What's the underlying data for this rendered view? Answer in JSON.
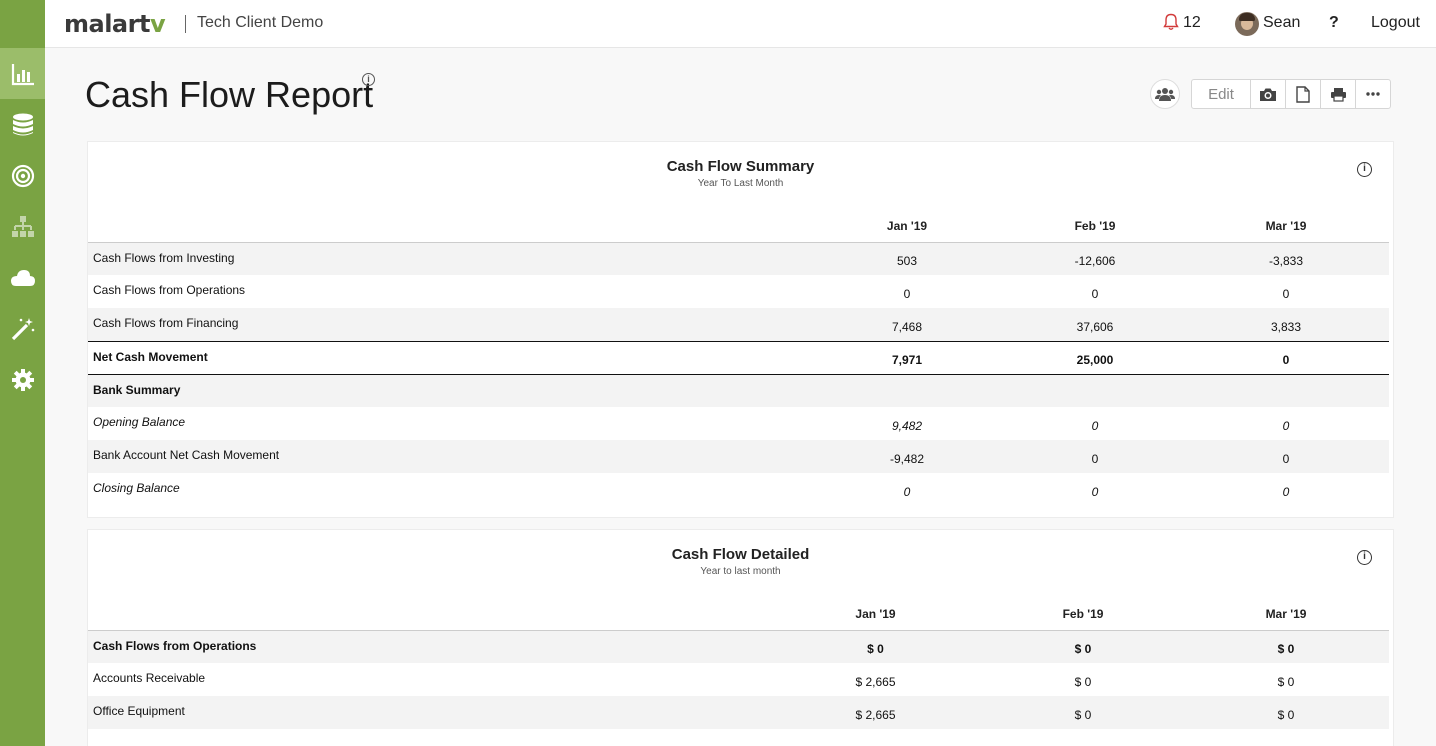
{
  "header": {
    "brand_prefix": "malart",
    "brand_suffix": "v",
    "client_name": "Tech Client Demo",
    "notification_count": "12",
    "user_name": "Sean",
    "help_label": "?",
    "logout_label": "Logout"
  },
  "sidebar": {
    "items": [
      {
        "name": "reports",
        "icon": "bar-chart-icon",
        "active": true
      },
      {
        "name": "data",
        "icon": "database-icon",
        "active": false
      },
      {
        "name": "goals",
        "icon": "target-icon",
        "active": false
      },
      {
        "name": "structure",
        "icon": "org-chart-icon",
        "active": false
      },
      {
        "name": "integrations",
        "icon": "cloud-icon",
        "active": false
      },
      {
        "name": "wizard",
        "icon": "magic-wand-icon",
        "active": false
      },
      {
        "name": "settings",
        "icon": "gear-icon",
        "active": false
      }
    ],
    "accent_color": "#7aa343"
  },
  "page": {
    "title": "Cash Flow Report",
    "info_icon": "i",
    "toolbar": {
      "edit_label": "Edit",
      "icons": [
        "group-icon",
        "camera-icon",
        "document-icon",
        "print-icon",
        "more-icon"
      ]
    }
  },
  "summary": {
    "title": "Cash Flow Summary",
    "subtitle": "Year To Last Month",
    "info_icon": "i",
    "columns": [
      "Jan '19",
      "Feb '19",
      "Mar '19"
    ],
    "rows": [
      {
        "label": "Cash Flows from Investing",
        "values": [
          "503",
          "-12,606",
          "-3,833"
        ]
      },
      {
        "label": "Cash Flows from Operations",
        "values": [
          "0",
          "0",
          "0"
        ]
      },
      {
        "label": "Cash Flows from Financing",
        "values": [
          "7,468",
          "37,606",
          "3,833"
        ]
      },
      {
        "label": "Net Cash Movement",
        "values": [
          "7,971",
          "25,000",
          "0"
        ]
      },
      {
        "label": "Bank Summary",
        "values": [
          "",
          "",
          ""
        ]
      },
      {
        "label": "Opening Balance",
        "values": [
          "9,482",
          "0",
          "0"
        ]
      },
      {
        "label": "Bank Account Net Cash Movement",
        "values": [
          "-9,482",
          "0",
          "0"
        ]
      },
      {
        "label": "Closing Balance",
        "values": [
          "0",
          "0",
          "0"
        ]
      }
    ]
  },
  "detailed": {
    "title": "Cash Flow Detailed",
    "subtitle": "Year to last month",
    "info_icon": "i",
    "columns": [
      "Jan '19",
      "Feb '19",
      "Mar '19"
    ],
    "rows": [
      {
        "label": "Cash Flows from Operations",
        "values": [
          "$ 0",
          "$ 0",
          "$ 0"
        ]
      },
      {
        "label": "Accounts Receivable",
        "values": [
          "$ 2,665",
          "$ 0",
          "$ 0"
        ]
      },
      {
        "label": "Office Equipment",
        "values": [
          "$ 2,665",
          "$ 0",
          "$ 0"
        ]
      }
    ]
  }
}
